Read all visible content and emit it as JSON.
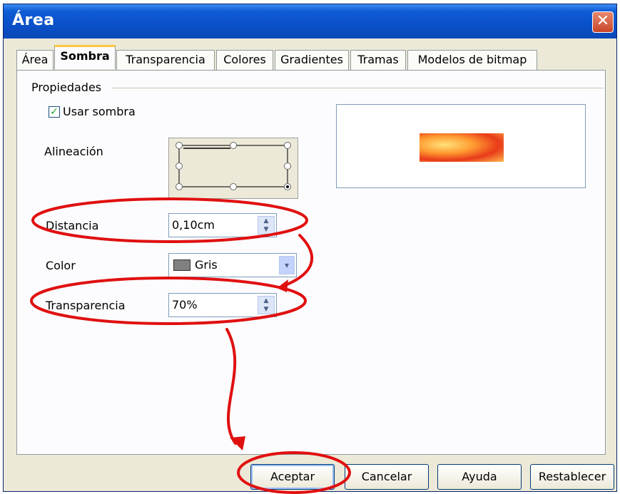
{
  "window": {
    "title": "Área"
  },
  "tabs": [
    {
      "label": "Área"
    },
    {
      "label": "Sombra"
    },
    {
      "label": "Transparencia"
    },
    {
      "label": "Colores"
    },
    {
      "label": "Gradientes"
    },
    {
      "label": "Tramas"
    },
    {
      "label": "Modelos de bitmap"
    }
  ],
  "active_tab": "Sombra",
  "properties": {
    "group_label": "Propiedades",
    "use_shadow_label": "Usar sombra",
    "use_shadow_checked": true,
    "alignment_label": "Alineación",
    "alignment_selected": "bottom-right",
    "distance_label": "Distancia",
    "distance_value": "0,10cm",
    "color_label": "Color",
    "color_value": "Gris",
    "color_swatch": "#808080",
    "transparency_label": "Transparencia",
    "transparency_value": "70%"
  },
  "buttons": {
    "ok": "Aceptar",
    "cancel": "Cancelar",
    "help": "Ayuda",
    "reset": "Restablecer"
  },
  "colors": {
    "titlebar": "#0a50c8",
    "annotation": "#e01010"
  }
}
